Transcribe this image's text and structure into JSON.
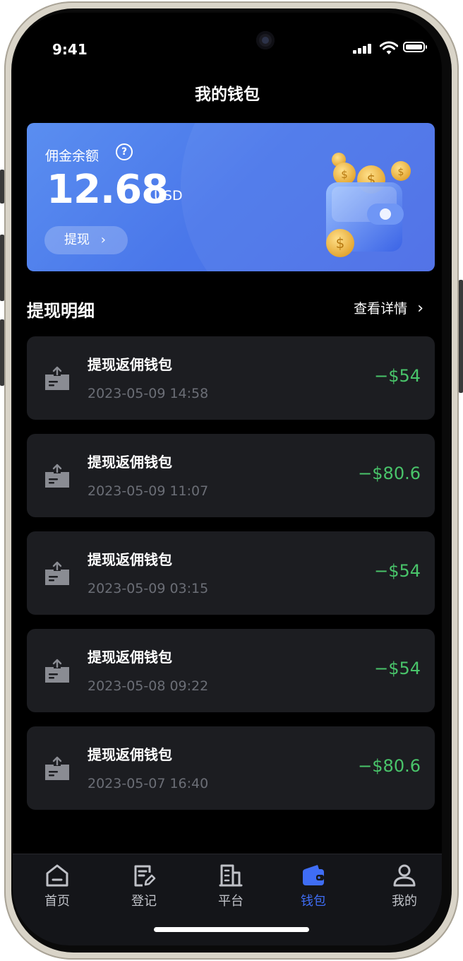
{
  "status_bar": {
    "time": "9:41"
  },
  "header": {
    "title": "我的钱包"
  },
  "balance_card": {
    "label": "佣金余额",
    "help_icon": "question-circle-icon",
    "amount": "12.68",
    "unit": "USD",
    "withdraw_label": "提现",
    "withdraw_chevron": "›"
  },
  "section": {
    "title": "提现明细",
    "link_label": "查看详情",
    "link_chevron": "›"
  },
  "transactions": [
    {
      "title": "提现返佣钱包",
      "date": "2023-05-09 14:58",
      "amount": "−$54"
    },
    {
      "title": "提现返佣钱包",
      "date": "2023-05-09 11:07",
      "amount": "−$80.6"
    },
    {
      "title": "提现返佣钱包",
      "date": "2023-05-09 03:15",
      "amount": "−$54"
    },
    {
      "title": "提现返佣钱包",
      "date": "2023-05-08 09:22",
      "amount": "−$54"
    },
    {
      "title": "提现返佣钱包",
      "date": "2023-05-07 16:40",
      "amount": "−$80.6"
    }
  ],
  "tab_bar": {
    "items": [
      {
        "label": "首页",
        "icon": "home-icon"
      },
      {
        "label": "登记",
        "icon": "edit-document-icon"
      },
      {
        "label": "平台",
        "icon": "building-icon"
      },
      {
        "label": "钱包",
        "icon": "wallet-icon"
      },
      {
        "label": "我的",
        "icon": "user-icon"
      }
    ],
    "active": "钱包"
  },
  "colors": {
    "accent": "#3f6df4",
    "amount_green": "#49c46a",
    "card_bg": "#4a77ea",
    "item_bg": "#1c1d21"
  }
}
